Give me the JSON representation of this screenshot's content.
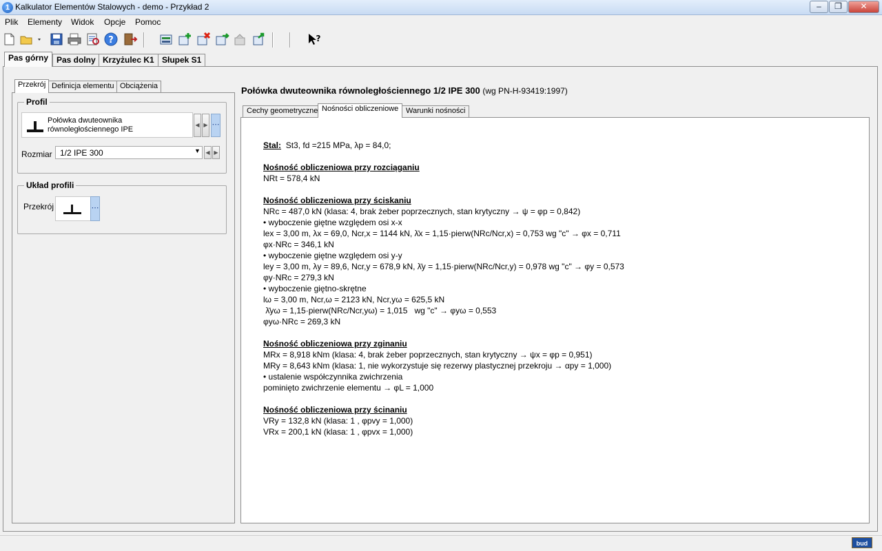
{
  "window": {
    "title": "Kalkulator Elementów Stalowych - demo - Przykład 2",
    "icon_letter": "1"
  },
  "menu": [
    "Plik",
    "Elementy",
    "Widok",
    "Opcje",
    "Pomoc"
  ],
  "outer_tabs": [
    "Pas górny",
    "Pas dolny",
    "Krzyżulec K1",
    "Słupek S1"
  ],
  "left_tabs": [
    "Przekrój",
    "Definicja elementu",
    "Obciążenia"
  ],
  "profile_group": {
    "title": "Profil",
    "profile_name_line1": "Połówka dwuteownika",
    "profile_name_line2": "równoległościennego IPE",
    "size_label": "Rozmiar",
    "size_value": "1/2 IPE 300"
  },
  "layout_group": {
    "title": "Układ profili",
    "section_label": "Przekrój"
  },
  "heading": {
    "main": "Połówka dwuteownika równoległościennego 1/2 IPE 300",
    "standard": "(wg PN-H-93419:1997)"
  },
  "right_tabs": [
    "Cechy geometryczne",
    "Nośności obliczeniowe",
    "Warunki nośności"
  ],
  "content": {
    "steel_label": "Stal:",
    "steel_text": "St3,  fd =215 MPa,  λp = 84,0;",
    "tension_title": "Nośność obliczeniowa przy rozciąganiu",
    "tension_lines": [
      "NRt = 578,4 kN"
    ],
    "compression_title": "Nośność obliczeniowa przy ściskaniu",
    "compression_lines": [
      "NRc = 487,0 kN  (klasa: 4, brak żeber poprzecznych, stan krytyczny  →  ψ  = φp = 0,842)",
      "• wyboczenie giętne względem osi x-x",
      "lex = 3,00 m,  λx = 69,0,  Ncr,x = 1144 kN,   λ̄x = 1,15·pierw(NRc/Ncr,x) = 0,753   wg \"c\" → φx = 0,711",
      "φx·NRc = 346,1 kN",
      "• wyboczenie giętne względem osi y-y",
      "ley = 3,00 m,  λy = 89,6,  Ncr,y = 678,9 kN,   λ̄y = 1,15·pierw(NRc/Ncr,y) = 0,978   wg \"c\" → φy = 0,573",
      "φy·NRc = 279,3 kN",
      "• wyboczenie giętno-skrętne",
      "lω = 3,00 m,  Ncr,ω = 2123 kN,  Ncr,yω = 625,5 kN",
      " λ̄yω = 1,15·pierw(NRc/Ncr,yω) = 1,015   wg \"c\" → φyω = 0,553",
      "φyω·NRc = 269,3 kN"
    ],
    "bending_title": "Nośność obliczeniowa przy zginaniu",
    "bending_lines": [
      "MRx = 8,918 kNm  (klasa: 4, brak żeber poprzecznych, stan krytyczny  →  ψx = φp = 0,951)",
      "MRy = 8,643 kNm  (klasa: 1,  nie wykorzystuje się rezerwy plastycznej przekroju  →  αpy = 1,000)",
      "• ustalenie współczynnika zwichrzenia",
      "pominięto zwichrzenie elementu → φL = 1,000"
    ],
    "shear_title": "Nośność obliczeniowa przy ścinaniu",
    "shear_lines": [
      "VRy = 132,8 kN  (klasa: 1 , φpvy = 1,000)",
      "VRx = 200,1 kN  (klasa: 1 , φpvx = 1,000)"
    ]
  },
  "status": {
    "logo_text": "bud"
  },
  "toolbar_icons": [
    "new-file-icon",
    "open-folder-icon",
    "save-icon",
    "print-icon",
    "print-preview-icon",
    "help-icon",
    "exit-icon",
    "element-list-icon",
    "add-element-icon",
    "delete-element-icon",
    "copy-element-icon",
    "disabled-element-icon",
    "export-element-icon",
    "context-help-icon"
  ]
}
